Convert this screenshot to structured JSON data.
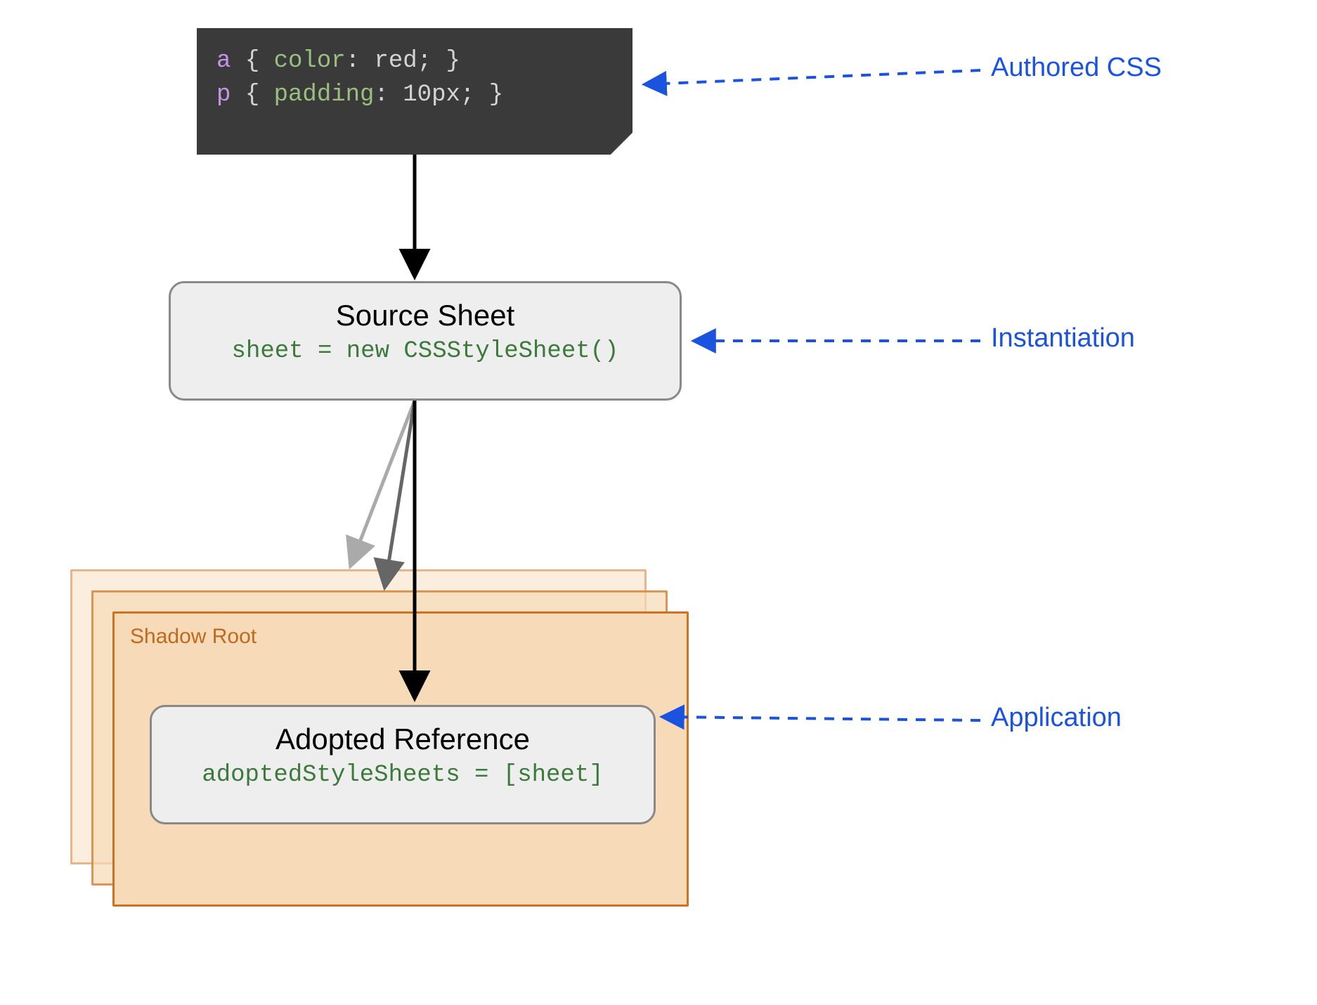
{
  "code": {
    "line1": {
      "selector": "a",
      "property": "color",
      "value": "red"
    },
    "line2": {
      "selector": "p",
      "property": "padding",
      "value": "10px"
    }
  },
  "source_sheet": {
    "title": "Source Sheet",
    "code": "sheet = new CSSStyleSheet()"
  },
  "shadow_root": {
    "label": "Shadow Root"
  },
  "adopted_ref": {
    "title": "Adopted Reference",
    "code": "adoptedStyleSheets = [sheet]"
  },
  "annotations": {
    "authored": "Authored CSS",
    "instantiation": "Instantiation",
    "application": "Application"
  },
  "colors": {
    "annotation": "#1953e0",
    "shadow_border": "#cc7323",
    "shadow_fill": "#f7dab7",
    "code_bg": "#3a3a3a"
  }
}
